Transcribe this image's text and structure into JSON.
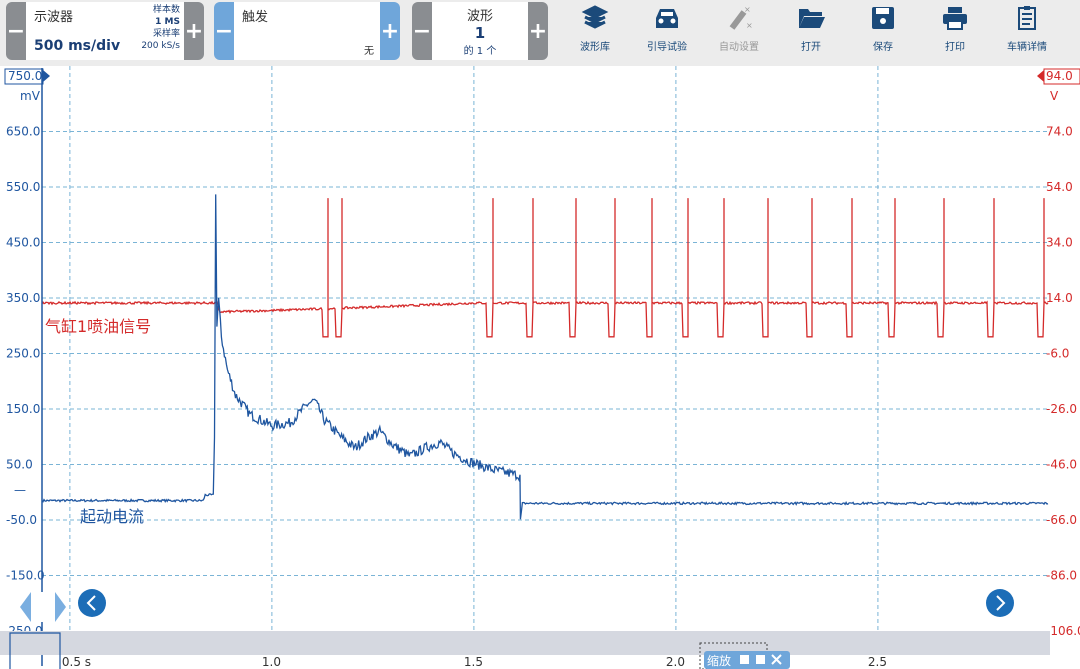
{
  "toolbar": {
    "timebase": {
      "title": "示波器",
      "value": "500 ms/div",
      "samples_label": "样本数",
      "samples": "1 MS",
      "rate_label": "采样率",
      "rate": "200 kS/s",
      "minus": "−",
      "plus": "+"
    },
    "trigger": {
      "title": "触发",
      "value": "无",
      "minus": "−",
      "plus": "+"
    },
    "waveform": {
      "title": "波形",
      "value": "1",
      "of": "的 1 个",
      "minus": "−",
      "plus": "+"
    },
    "tools": [
      {
        "label": "波形库",
        "icon": "waveform-library-icon"
      },
      {
        "label": "引导试验",
        "icon": "car-icon"
      },
      {
        "label": "自动设置",
        "icon": "auto-setup-icon",
        "disabled": true
      },
      {
        "label": "打开",
        "icon": "folder-open-icon"
      },
      {
        "label": "保存",
        "icon": "save-icon"
      },
      {
        "label": "打印",
        "icon": "print-icon"
      },
      {
        "label": "车辆详情",
        "icon": "clipboard-icon"
      }
    ]
  },
  "zoom_box": {
    "label": "缩放"
  },
  "colors": {
    "blue": "#1f56a0",
    "red": "#d42a2a",
    "grid": "#7ab4d6"
  },
  "chart_data": {
    "type": "line",
    "x_unit": "s",
    "xlim": [
      0.431,
      2.921
    ],
    "x_ticks": [
      "0.5 s",
      "1.0",
      "1.5",
      "2.0",
      "2.5"
    ],
    "x_tick_values": [
      0.5,
      1.0,
      1.5,
      2.0,
      2.5
    ],
    "grid": true,
    "left_axis": {
      "unit": "mV",
      "ylim": [
        -250,
        750
      ],
      "ticks": [
        "750.0",
        "650.0",
        "550.0",
        "450.0",
        "350.0",
        "250.0",
        "150.0",
        "50.0",
        "-50.0",
        "-150.0",
        "-250.0"
      ]
    },
    "right_axis": {
      "unit": "V",
      "ylim": [
        -106,
        94
      ],
      "ticks": [
        "94.0",
        "74.0",
        "54.0",
        "34.0",
        "14.0",
        "-6.0",
        "-26.0",
        "-46.0",
        "-66.0",
        "-86.0",
        "-106.0"
      ]
    },
    "series": [
      {
        "name": "起动电流",
        "axis": "left",
        "color": "#1f56a0",
        "points": [
          [
            0.431,
            -15
          ],
          [
            0.83,
            -15
          ],
          [
            0.835,
            -5
          ],
          [
            0.855,
            -5
          ],
          [
            0.858,
            100
          ],
          [
            0.861,
            536
          ],
          [
            0.864,
            300
          ],
          [
            0.868,
            350
          ],
          [
            0.875,
            280
          ],
          [
            0.89,
            220
          ],
          [
            0.91,
            175
          ],
          [
            0.946,
            140
          ],
          [
            1.0,
            120
          ],
          [
            1.045,
            125
          ],
          [
            1.09,
            160
          ],
          [
            1.106,
            165
          ],
          [
            1.13,
            130
          ],
          [
            1.17,
            100
          ],
          [
            1.205,
            80
          ],
          [
            1.24,
            100
          ],
          [
            1.267,
            110
          ],
          [
            1.3,
            85
          ],
          [
            1.342,
            65
          ],
          [
            1.38,
            80
          ],
          [
            1.416,
            90
          ],
          [
            1.45,
            70
          ],
          [
            1.49,
            55
          ],
          [
            1.55,
            40
          ],
          [
            1.614,
            30
          ],
          [
            1.615,
            -50
          ],
          [
            1.62,
            -20
          ],
          [
            2.921,
            -20
          ]
        ]
      },
      {
        "name": "气缸1喷油信号",
        "axis": "right",
        "color": "#d42a2a",
        "baseline": [
          [
            0.431,
            12.2
          ],
          [
            0.865,
            12.2
          ],
          [
            0.87,
            9
          ],
          [
            1.0,
            9.5
          ],
          [
            1.3,
            11
          ],
          [
            1.5,
            12.2
          ],
          [
            2.921,
            12.2
          ]
        ],
        "dip_level": 0,
        "spike_level": 50,
        "pulse_times": [
          1.139,
          1.173,
          1.547,
          1.646,
          1.752,
          1.849,
          1.941,
          2.03,
          2.119,
          2.228,
          2.337,
          2.436,
          2.542,
          2.663,
          2.787,
          2.911
        ]
      }
    ]
  }
}
